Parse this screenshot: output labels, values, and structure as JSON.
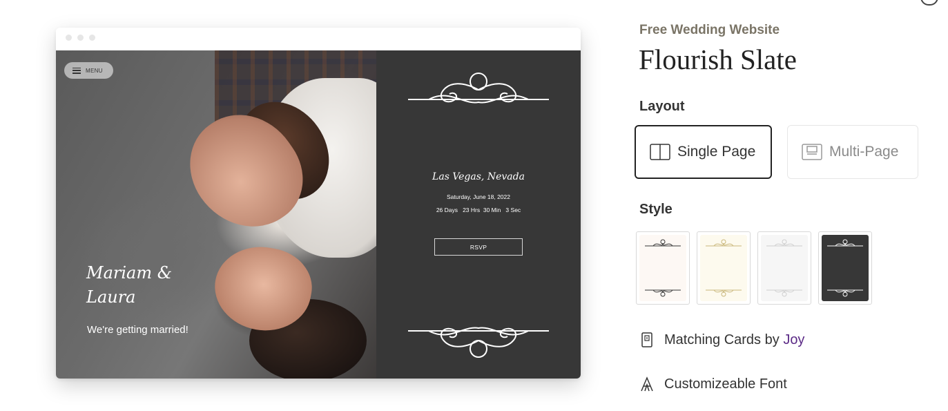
{
  "preview": {
    "menu_label": "MENU",
    "names_line1": "Mariam &",
    "names_line2": "Laura",
    "tagline": "We're getting married!",
    "location": "Las Vegas, Nevada",
    "date": "Saturday, June 18, 2022",
    "countdown": "26 Days   23 Hrs  30 Min   3 Sec",
    "rsvp_label": "RSVP"
  },
  "details": {
    "eyebrow": "Free Wedding Website",
    "title": "Flourish Slate",
    "layout_heading": "Layout",
    "layout_options": [
      {
        "label": "Single Page",
        "selected": true,
        "icon": "single-page-icon"
      },
      {
        "label": "Multi-Page",
        "selected": false,
        "icon": "multi-page-icon"
      }
    ],
    "style_heading": "Style",
    "styles": [
      {
        "name": "cream",
        "bg": "#fdf8f4",
        "ornament": "#333333"
      },
      {
        "name": "ivory-gold",
        "bg": "#fdfaee",
        "ornament": "#c9b77a"
      },
      {
        "name": "light-gray",
        "bg": "#f6f6f6",
        "ornament": "#cfcfcf"
      },
      {
        "name": "slate",
        "bg": "#373737",
        "ornament": "#ffffff",
        "selected": true
      }
    ],
    "feature_cards_prefix": "Matching Cards by",
    "feature_cards_brand": "Joy",
    "feature_font": "Customizeable Font"
  },
  "colors": {
    "accent": "#5b2a86",
    "panel": "#373737",
    "eyebrow": "#7a7466"
  }
}
